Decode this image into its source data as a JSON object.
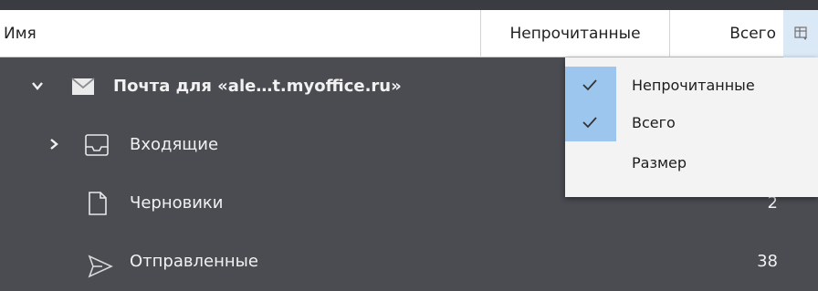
{
  "columns": {
    "name": "Имя",
    "unread": "Непрочитанные",
    "total": "Всего",
    "picker_icon": "column-chooser-icon"
  },
  "account": {
    "label": "Почта для «ale…t.myoffice.ru»",
    "icon": "envelope-icon",
    "expanded": true
  },
  "folders": [
    {
      "label": "Входящие",
      "icon": "inbox-tray-icon",
      "count": "",
      "collapsed": true
    },
    {
      "label": "Черновики",
      "icon": "document-icon",
      "count": "2"
    },
    {
      "label": "Отправленные",
      "icon": "send-arrow-icon",
      "count": "38"
    }
  ],
  "column_menu": {
    "items": [
      {
        "label": "Непрочитанные",
        "checked": true
      },
      {
        "label": "Всего",
        "checked": true
      },
      {
        "label": "Размер",
        "checked": false
      }
    ]
  },
  "colors": {
    "background": "#4a4c52",
    "header_bg": "#ffffff",
    "check_highlight": "#9cc6ee",
    "menu_bg": "#f3f3f3"
  }
}
